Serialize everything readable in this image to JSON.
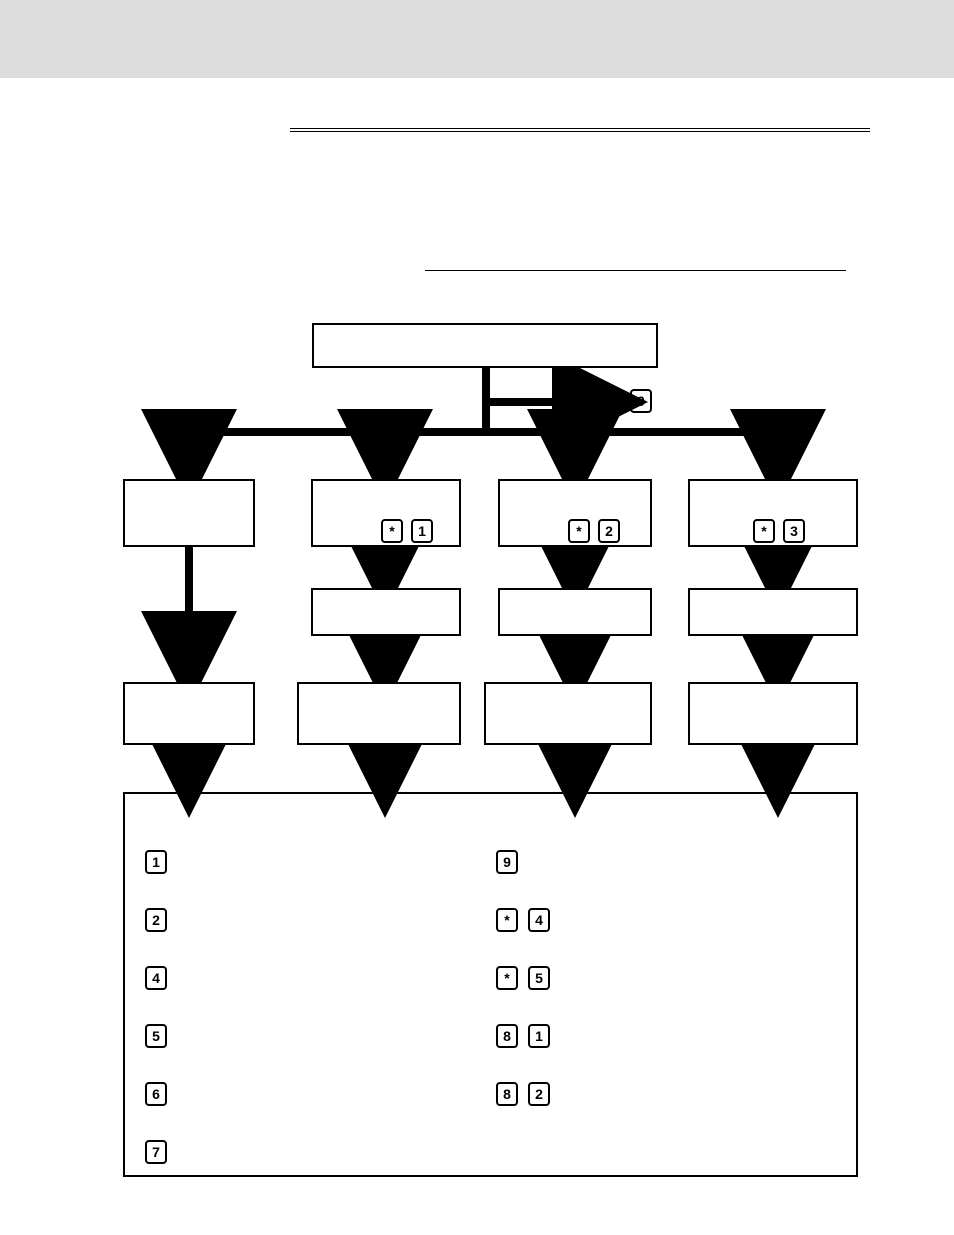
{
  "flow": {
    "root_label": "",
    "zero_key": "0",
    "branches": [
      {
        "keys": [],
        "label": "",
        "sub": "",
        "final": ""
      },
      {
        "keys": [
          "*",
          "1"
        ],
        "label": "",
        "sub": "",
        "final": ""
      },
      {
        "keys": [
          "*",
          "2"
        ],
        "label": "",
        "sub": "",
        "final": ""
      },
      {
        "keys": [
          "*",
          "3"
        ],
        "label": "",
        "sub": "",
        "final": ""
      }
    ]
  },
  "options": {
    "left": [
      {
        "keys": [
          "1"
        ],
        "label": ""
      },
      {
        "keys": [
          "2"
        ],
        "label": ""
      },
      {
        "keys": [
          "4"
        ],
        "label": ""
      },
      {
        "keys": [
          "5"
        ],
        "label": ""
      },
      {
        "keys": [
          "6"
        ],
        "label": ""
      },
      {
        "keys": [
          "7"
        ],
        "label": ""
      }
    ],
    "right": [
      {
        "keys": [
          "9"
        ],
        "label": ""
      },
      {
        "keys": [
          "*",
          "4"
        ],
        "label": ""
      },
      {
        "keys": [
          "*",
          "5"
        ],
        "label": ""
      },
      {
        "keys": [
          "8",
          "1"
        ],
        "label": ""
      },
      {
        "keys": [
          "8",
          "2"
        ],
        "label": ""
      }
    ]
  }
}
